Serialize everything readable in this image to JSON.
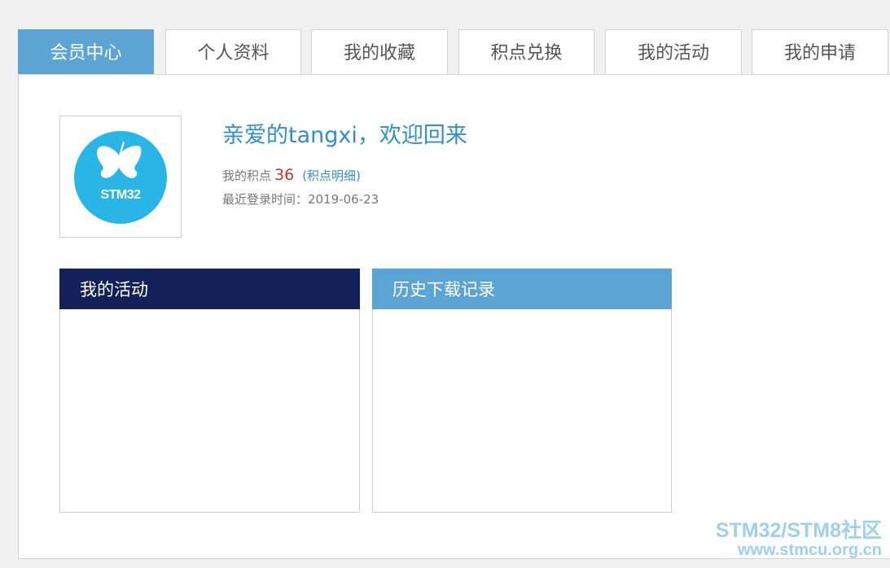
{
  "tabs": [
    {
      "label": "会员中心"
    },
    {
      "label": "个人资料"
    },
    {
      "label": "我的收藏"
    },
    {
      "label": "积点兑换"
    },
    {
      "label": "我的活动"
    },
    {
      "label": "我的申请"
    }
  ],
  "active_tab": "会员中心",
  "profile": {
    "avatar_logo_text": "STM32",
    "welcome": "亲爱的tangxi，欢迎回来",
    "points_label": "我的积点",
    "points_value": "36",
    "points_link": "(积点明细)",
    "last_login_label": "最近登录时间：",
    "last_login_value": "2019-06-23"
  },
  "boxes": {
    "activities_title": "我的活动",
    "downloads_title": "历史下载记录"
  },
  "watermark": {
    "line1": "STM32/STM8社区",
    "line2": "www.stmcu.org.cn"
  },
  "colors": {
    "accent": "#5ba4d3",
    "dark_header": "#142058",
    "link": "#2f8fc7",
    "points": "#c0392b",
    "logo": "#29b6e6"
  },
  "icons": {
    "avatar": "butterfly-logo-icon"
  }
}
